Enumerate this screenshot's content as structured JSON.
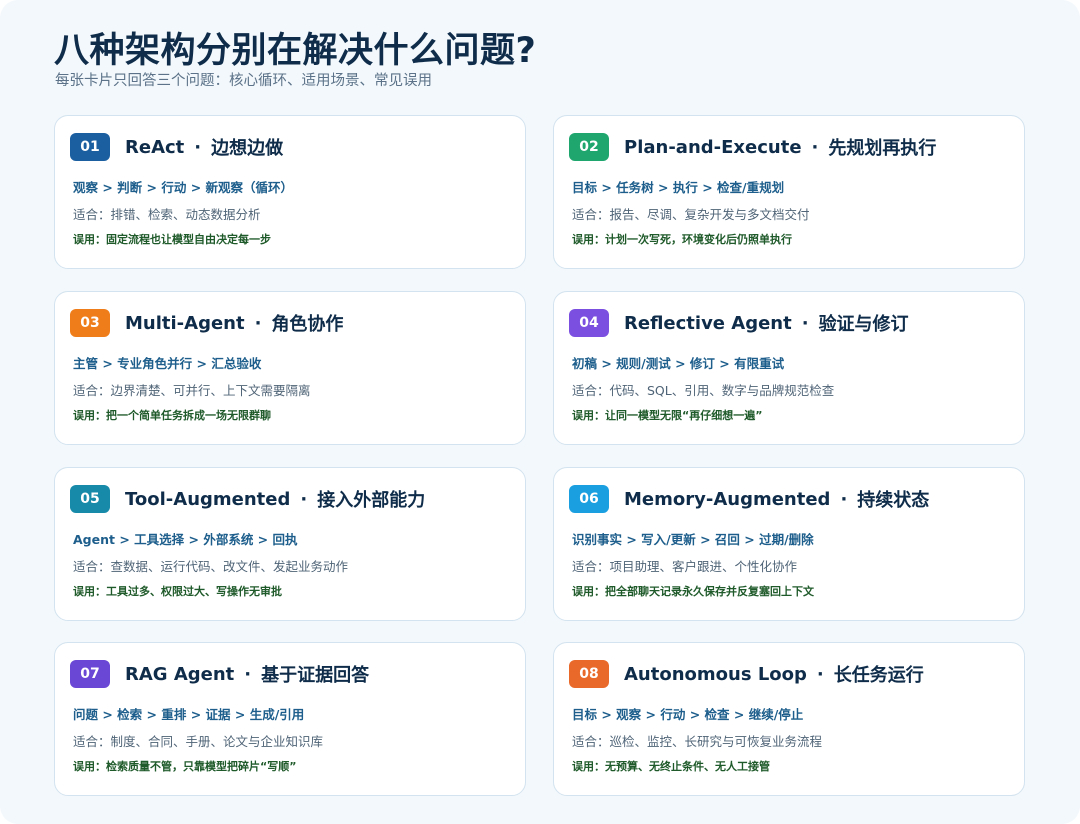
{
  "header": {
    "title": "八种架构分别在解决什么问题?",
    "subtitle": "每张卡片只回答三个问题：核心循环、适用场景、常见误用"
  },
  "separator": "·",
  "cards": [
    {
      "number": "01",
      "color": "#1b5fa0",
      "name": "ReAct",
      "tagline": "边想边做",
      "flow": "观察 > 判断 > 行动 > 新观察（循环）",
      "suitable": "适合：排错、检索、动态数据分析",
      "misuse": "误用：固定流程也让模型自由决定每一步"
    },
    {
      "number": "02",
      "color": "#1ea66e",
      "name": "Plan-and-Execute",
      "tagline": "先规划再执行",
      "flow": "目标 > 任务树 > 执行 > 检查/重规划",
      "suitable": "适合：报告、尽调、复杂开发与多文档交付",
      "misuse": "误用：计划一次写死，环境变化后仍照单执行"
    },
    {
      "number": "03",
      "color": "#ef7d1a",
      "name": "Multi-Agent",
      "tagline": "角色协作",
      "flow": "主管 > 专业角色并行 > 汇总验收",
      "suitable": "适合：边界清楚、可并行、上下文需要隔离",
      "misuse": "误用：把一个简单任务拆成一场无限群聊"
    },
    {
      "number": "04",
      "color": "#7b4fe0",
      "name": "Reflective Agent",
      "tagline": "验证与修订",
      "flow": "初稿 > 规则/测试 > 修订 > 有限重试",
      "suitable": "适合：代码、SQL、引用、数字与品牌规范检查",
      "misuse": "误用：让同一模型无限“再仔细想一遍”"
    },
    {
      "number": "05",
      "color": "#168aa8",
      "name": "Tool-Augmented",
      "tagline": "接入外部能力",
      "flow": "Agent > 工具选择 > 外部系统 > 回执",
      "suitable": "适合：查数据、运行代码、改文件、发起业务动作",
      "misuse": "误用：工具过多、权限过大、写操作无审批"
    },
    {
      "number": "06",
      "color": "#1a9fe0",
      "name": "Memory-Augmented",
      "tagline": "持续状态",
      "flow": "识别事实 > 写入/更新 > 召回 > 过期/删除",
      "suitable": "适合：项目助理、客户跟进、个性化协作",
      "misuse": "误用：把全部聊天记录永久保存并反复塞回上下文"
    },
    {
      "number": "07",
      "color": "#6a47d4",
      "name": "RAG Agent",
      "tagline": "基于证据回答",
      "flow": "问题 > 检索 > 重排 > 证据 > 生成/引用",
      "suitable": "适合：制度、合同、手册、论文与企业知识库",
      "misuse": "误用：检索质量不管，只靠模型把碎片“写顺”"
    },
    {
      "number": "08",
      "color": "#e8692a",
      "name": "Autonomous Loop",
      "tagline": "长任务运行",
      "flow": "目标 > 观察 > 行动 > 检查 > 继续/停止",
      "suitable": "适合：巡检、监控、长研究与可恢复业务流程",
      "misuse": "误用：无预算、无终止条件、无人工接管"
    }
  ]
}
